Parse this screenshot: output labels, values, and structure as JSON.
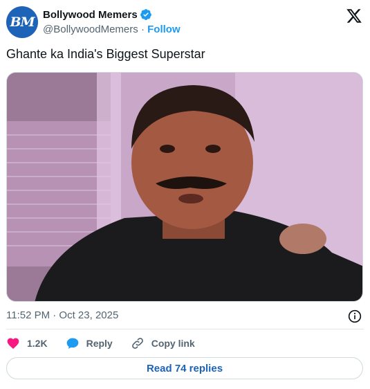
{
  "author": {
    "avatar_initials": "BM",
    "display_name": "Bollywood Memers",
    "handle": "@BollywoodMemers",
    "separator": "·",
    "follow_label": "Follow",
    "verified": true
  },
  "tweet": {
    "text": "Ghante ka India's Biggest Superstar",
    "timestamp": "11:52 PM · Oct 23, 2025"
  },
  "actions": {
    "like_count": "1.2K",
    "reply_label": "Reply",
    "copy_link_label": "Copy link"
  },
  "read_replies_label": "Read 74 replies",
  "colors": {
    "brand_blue": "#1d9bf0",
    "like_pink": "#f91880",
    "link_dark_blue": "#1d63b8",
    "text_secondary": "#536471"
  },
  "icons": [
    "verified-badge-icon",
    "x-logo-icon",
    "info-icon",
    "heart-icon",
    "reply-bubble-icon",
    "link-icon"
  ]
}
